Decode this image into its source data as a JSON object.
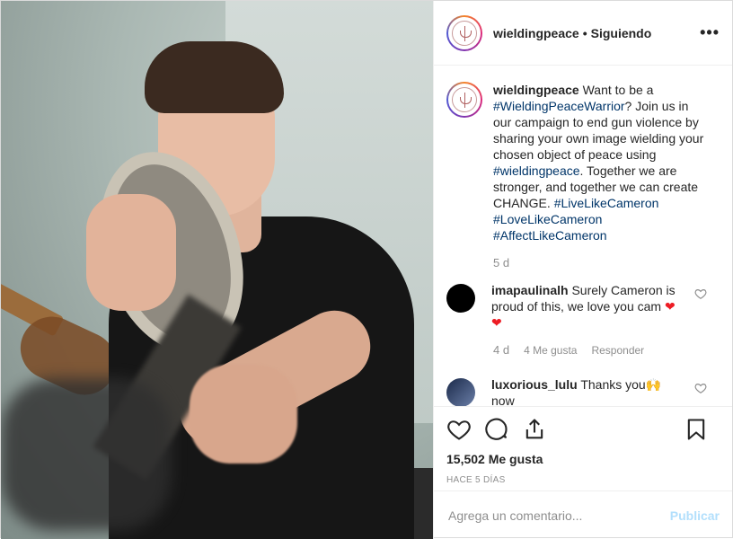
{
  "header": {
    "username": "wieldingpeace",
    "separator": "•",
    "follow_status": "Siguiendo",
    "more_icon": "more-options-icon",
    "more_glyph": "•••"
  },
  "caption": {
    "username": "wieldingpeace",
    "text_1": " Want to be a ",
    "tag_1": "#WieldingPeaceWarrior",
    "text_2": "? Join us in our campaign to end gun violence by sharing your own image wielding your chosen object of peace using ",
    "tag_2": "#wieldingpeace",
    "text_3": ". Together we are stronger, and together we can create CHANGE. ",
    "tag_3": "#LiveLikeCameron",
    "tag_4": "#LoveLikeCameron",
    "tag_5": "#AffectLikeCameron",
    "time": "5 d"
  },
  "comments": [
    {
      "username": "imapaulinalh",
      "text": " Surely Cameron is proud of this, we love you cam ",
      "emoji_1": "❤",
      "emoji_2": "❤",
      "time": "4 d",
      "likes": "4 Me gusta",
      "reply": "Responder"
    },
    {
      "username": "luxorious_lulu",
      "text": " Thanks you",
      "emoji": "🙌",
      "text_after": " now"
    }
  ],
  "actions": {
    "likes": "15,502 Me gusta",
    "posted": "HACE 5 DÍAS",
    "icons": [
      "heart-icon",
      "comment-icon",
      "share-icon",
      "bookmark-icon"
    ]
  },
  "comment_box": {
    "placeholder": "Agrega un comentario...",
    "publish": "Publicar"
  },
  "colors": {
    "hashtag": "#003569",
    "muted": "#8e8e8e",
    "publish_disabled": "#b2dffc",
    "heart_red": "#ed1c24"
  }
}
